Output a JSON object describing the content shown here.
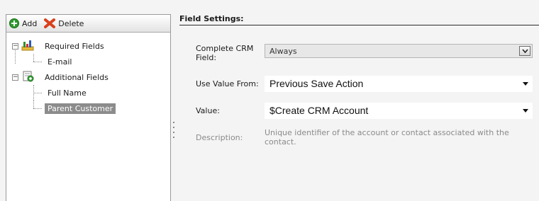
{
  "toolbar": {
    "add_label": "Add",
    "delete_label": "Delete"
  },
  "tree": {
    "required": {
      "label": "Required Fields",
      "children": [
        "E-mail"
      ]
    },
    "additional": {
      "label": "Additional Fields",
      "children": [
        "Full Name",
        "Parent Customer"
      ]
    },
    "selected": "Parent Customer"
  },
  "settings": {
    "header": "Field Settings:",
    "complete_crm_label": "Complete CRM Field:",
    "complete_crm_value": "Always",
    "use_value_from_label": "Use Value From:",
    "use_value_from_value": "Previous Save Action",
    "value_label": "Value:",
    "value_value": "$Create CRM Account",
    "description_label": "Description:",
    "description_text": "Unique identifier of the account or contact associated with the contact."
  },
  "colors": {
    "selected_bg": "#8c8c8c",
    "add_icon": "#2e9a2e",
    "delete_icon": "#d8401c"
  },
  "icons": {
    "add": "plus-circle-icon",
    "delete": "x-icon",
    "required_folder": "chart-folder-icon",
    "additional_folder": "page-folder-icon"
  }
}
